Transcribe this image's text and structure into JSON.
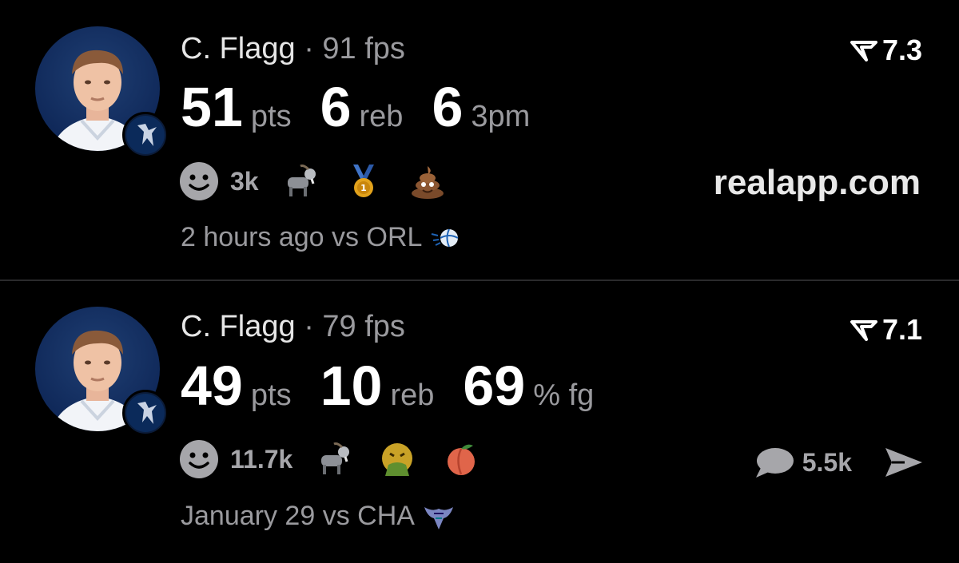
{
  "posts": [
    {
      "player": "C. Flagg",
      "separator": "·",
      "fps": "91 fps",
      "rating": "7.3",
      "stats": [
        {
          "value": "51",
          "unit": "pts"
        },
        {
          "value": "6",
          "unit": "reb"
        },
        {
          "value": "6",
          "unit": "3pm"
        }
      ],
      "reaction_count": "3k",
      "emojis": [
        "goat-emoji",
        "medal-emoji",
        "poop-emoji"
      ],
      "site": "realapp.com",
      "time": "2 hours ago",
      "opponent": "vs ORL",
      "opponent_icon": "magic-logo-icon"
    },
    {
      "player": "C. Flagg",
      "separator": "·",
      "fps": "79 fps",
      "rating": "7.1",
      "stats": [
        {
          "value": "49",
          "unit": "pts"
        },
        {
          "value": "10",
          "unit": "reb"
        },
        {
          "value": "69",
          "unit": "% fg"
        }
      ],
      "reaction_count": "11.7k",
      "emojis": [
        "goat-emoji",
        "vomit-emoji",
        "peach-emoji"
      ],
      "comment_count": "5.5k",
      "time": "January 29",
      "opponent": "vs CHA",
      "opponent_icon": "hornets-logo-icon"
    }
  ],
  "colors": {
    "background": "#000000",
    "muted": "#9a9a9e",
    "divider": "#2a2a2c"
  }
}
